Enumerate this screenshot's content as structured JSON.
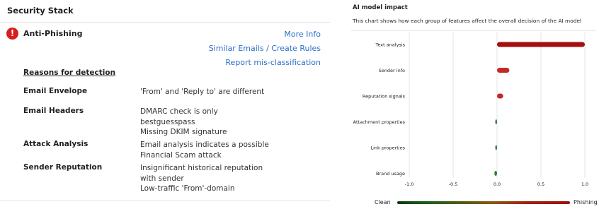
{
  "left": {
    "title": "Security Stack",
    "alert_title": "Anti-Phishing",
    "alert_icon": "!",
    "links": [
      "More Info",
      "Similar Emails / Create Rules",
      "Report mis-classification"
    ],
    "reasons_title": "Reasons for detection",
    "rows": [
      {
        "label": "Email Envelope",
        "values": [
          "'From' and 'Reply to' are different"
        ]
      },
      {
        "label": "Email Headers",
        "values": [
          "DMARC check is only",
          "bestguesspass",
          "Missing DKIM signature"
        ]
      },
      {
        "label": "Attack Analysis",
        "values": [
          "Email analysis indicates a possible",
          "Financial Scam attack"
        ]
      },
      {
        "label": "Sender Reputation",
        "values": [
          "Insignificant historical reputation",
          "with sender",
          "Low-traffic 'From'-domain"
        ]
      }
    ]
  },
  "right": {
    "title": "AI model impact",
    "subtitle": "This chart shows how each group of features affect the overall decision of the AI model",
    "gradient_left": "Clean",
    "gradient_right": "Phishing",
    "colors": {
      "positive": "#c62828",
      "positive_dark": "#a50f0f",
      "negative": "#2e7d32"
    }
  },
  "chart_data": {
    "type": "bar",
    "orientation": "horizontal",
    "categories": [
      "Text analysis",
      "Sender info",
      "Reputation signals",
      "Attachment properties",
      "Link properties",
      "Brand usage"
    ],
    "values": [
      1.0,
      0.14,
      0.07,
      -0.02,
      -0.02,
      -0.03
    ],
    "xlim": [
      -1.0,
      1.0
    ],
    "xticks": [
      "-1.0",
      "-0.5",
      "0.0",
      "0.5",
      "1.0"
    ],
    "grid": true
  }
}
